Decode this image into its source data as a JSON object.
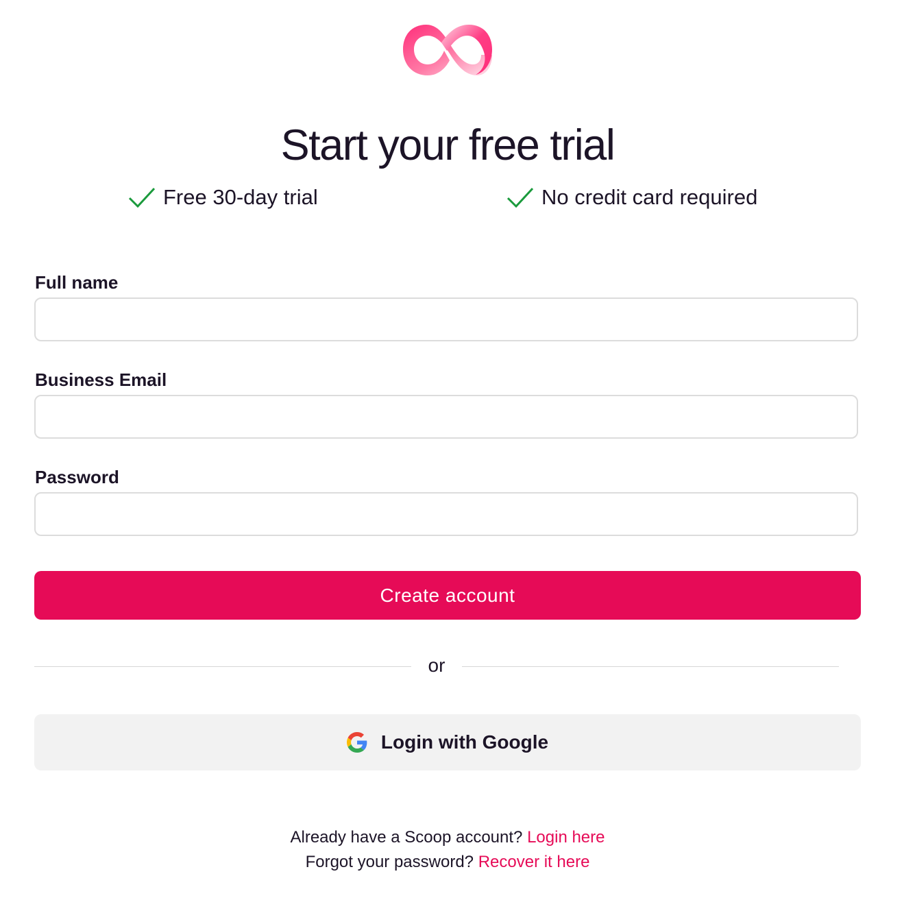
{
  "logo": {
    "icon": "infinity-loop-logo-icon",
    "colors": [
      "#ff2e7a",
      "#ff9fbe",
      "#ffd6e4"
    ]
  },
  "title": "Start your free trial",
  "perks": [
    {
      "icon": "check-icon",
      "text": "Free 30-day trial"
    },
    {
      "icon": "check-icon",
      "text": "No credit card required"
    }
  ],
  "form": {
    "full_name": {
      "label": "Full name",
      "value": "",
      "placeholder": ""
    },
    "email": {
      "label": "Business Email",
      "value": "",
      "placeholder": ""
    },
    "password": {
      "label": "Password",
      "value": "",
      "placeholder": ""
    },
    "submit_label": "Create account"
  },
  "divider_text": "or",
  "google": {
    "icon": "google-g-icon",
    "label": "Login with Google"
  },
  "footer": {
    "login_prompt": "Already have a Scoop account?",
    "login_link": "Login here",
    "recover_prompt": "Forgot your password?",
    "recover_link": "Recover it here"
  },
  "colors": {
    "accent": "#e60b57",
    "check": "#1a9a3c",
    "text": "#1c1427",
    "google_button_bg": "#f2f2f2"
  }
}
